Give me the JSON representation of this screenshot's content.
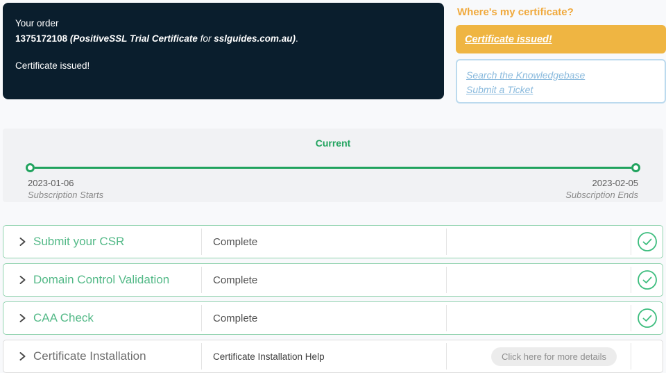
{
  "order_panel": {
    "intro": "Your order",
    "number": "1375172108",
    "cert_name": "(PositiveSSL Trial Certificate",
    "connector": "for",
    "domain": "sslguides.com.au)",
    "period": ".",
    "status": "Certificate issued!"
  },
  "certificate_panel": {
    "heading": "Where's my certificate?",
    "button_label": "Certificate issued!",
    "links": [
      {
        "label": "Search the Knowledgebase"
      },
      {
        "label": "Submit a Ticket"
      }
    ]
  },
  "timeline": {
    "current_label": "Current",
    "start": {
      "date": "2023-01-06",
      "label": "Subscription Starts"
    },
    "end": {
      "date": "2023-02-05",
      "label": "Subscription Ends"
    }
  },
  "steps": [
    {
      "title": "Submit your CSR",
      "status": "Complete",
      "complete": true
    },
    {
      "title": "Domain Control Validation",
      "status": "Complete",
      "complete": true
    },
    {
      "title": "CAA Check",
      "status": "Complete",
      "complete": true
    },
    {
      "title": "Certificate Installation",
      "status": "Certificate Installation Help",
      "action_label": "Click here for more details",
      "complete": false
    }
  ],
  "colors": {
    "accent_green": "#21a35e",
    "title_green": "#53b987",
    "border_green": "#90d2ae",
    "amber": "#efb542",
    "amber_text": "#f0a93c",
    "navy": "#0a1e2d",
    "link_blue": "#8abadd"
  }
}
